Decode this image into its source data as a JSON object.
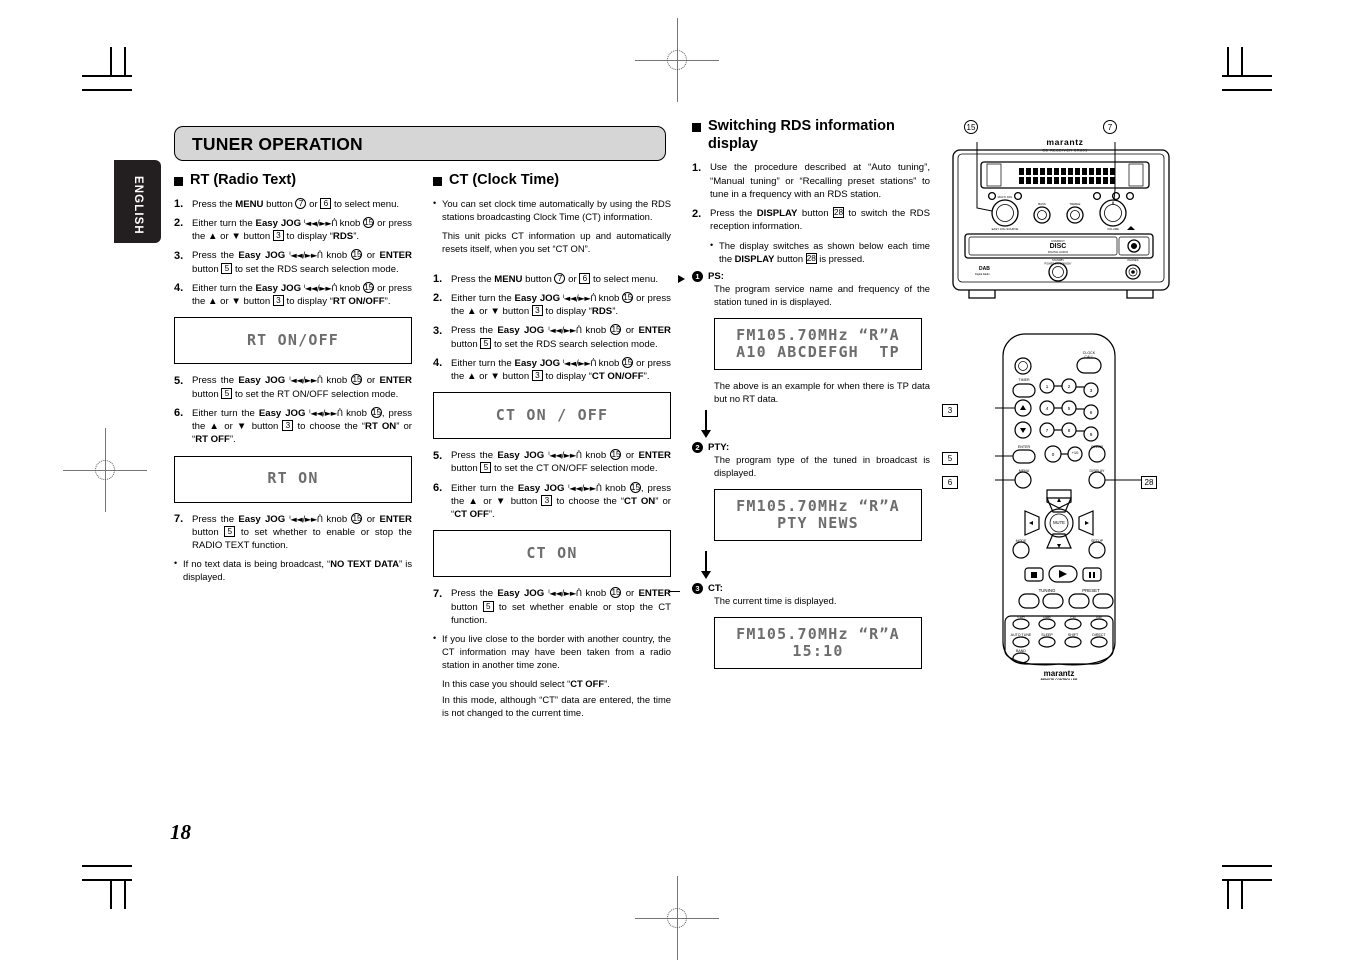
{
  "page": {
    "number": "18",
    "language_tab": "ENGLISH",
    "section_title": "TUNER OPERATION"
  },
  "column_left": {
    "heading": "RT (Radio Text)",
    "steps": [
      {
        "num": "1.",
        "parts": [
          {
            "t": "Press the "
          },
          {
            "t": "MENU",
            "b": true
          },
          {
            "t": " button "
          },
          {
            "t": "7",
            "ref": "circle"
          },
          {
            "t": " or "
          },
          {
            "t": "6",
            "ref": "square"
          },
          {
            "t": " to select menu."
          }
        ]
      },
      {
        "num": "2.",
        "parts": [
          {
            "t": "Either turn the "
          },
          {
            "t": "Easy JOG",
            "b": true
          },
          {
            "t": " ᑊ◄◄/►►ᑏ ",
            "jog": true
          },
          {
            "t": "knob "
          },
          {
            "t": "15",
            "ref": "circle"
          },
          {
            "t": " or press the ▲ or ▼ button "
          },
          {
            "t": "3",
            "ref": "square"
          },
          {
            "t": " to display “"
          },
          {
            "t": "RDS",
            "b": true
          },
          {
            "t": "”."
          }
        ]
      },
      {
        "num": "3.",
        "parts": [
          {
            "t": "Press the "
          },
          {
            "t": "Easy JOG",
            "b": true
          },
          {
            "t": " ᑊ◄◄/►►ᑏ ",
            "jog": true
          },
          {
            "t": "knob "
          },
          {
            "t": "15",
            "ref": "circle"
          },
          {
            "t": " or "
          },
          {
            "t": "ENTER",
            "b": true
          },
          {
            "t": " button "
          },
          {
            "t": "5",
            "ref": "square"
          },
          {
            "t": " to set the RDS search selection mode."
          }
        ]
      },
      {
        "num": "4.",
        "parts": [
          {
            "t": "Either turn the "
          },
          {
            "t": "Easy JOG",
            "b": true
          },
          {
            "t": " ᑊ◄◄/►►ᑏ ",
            "jog": true
          },
          {
            "t": "knob "
          },
          {
            "t": "15",
            "ref": "circle"
          },
          {
            "t": " or press the ▲ or ▼ button "
          },
          {
            "t": "3",
            "ref": "square"
          },
          {
            "t": " to display “"
          },
          {
            "t": "RT ON/OFF",
            "b": true
          },
          {
            "t": "”."
          }
        ]
      }
    ],
    "lcd_1": {
      "lines": [
        "RT ON/OFF"
      ]
    },
    "steps_2": [
      {
        "num": "5.",
        "parts": [
          {
            "t": "Press the "
          },
          {
            "t": "Easy JOG",
            "b": true
          },
          {
            "t": " ᑊ◄◄/►►ᑏ ",
            "jog": true
          },
          {
            "t": "knob "
          },
          {
            "t": "15",
            "ref": "circle"
          },
          {
            "t": " or "
          },
          {
            "t": "ENTER",
            "b": true
          },
          {
            "t": " button "
          },
          {
            "t": "5",
            "ref": "square"
          },
          {
            "t": " to set the RT ON/OFF selection mode."
          }
        ]
      },
      {
        "num": "6.",
        "parts": [
          {
            "t": "Either turn the "
          },
          {
            "t": "Easy JOG",
            "b": true
          },
          {
            "t": " ᑊ◄◄/►►ᑏ ",
            "jog": true
          },
          {
            "t": "knob "
          },
          {
            "t": "15",
            "ref": "circle"
          },
          {
            "t": ", press the ▲ or ▼ button "
          },
          {
            "t": "3",
            "ref": "square"
          },
          {
            "t": " to choose the “"
          },
          {
            "t": "RT ON",
            "b": true
          },
          {
            "t": "” or “"
          },
          {
            "t": "RT OFF",
            "b": true
          },
          {
            "t": "”."
          }
        ]
      }
    ],
    "lcd_2": {
      "lines": [
        "RT ON"
      ]
    },
    "steps_3": [
      {
        "num": "7.",
        "parts": [
          {
            "t": "Press the "
          },
          {
            "t": "Easy JOG",
            "b": true
          },
          {
            "t": " ᑊ◄◄/►►ᑏ ",
            "jog": true
          },
          {
            "t": "knob "
          },
          {
            "t": "15",
            "ref": "circle"
          },
          {
            "t": " or "
          },
          {
            "t": "ENTER",
            "b": true
          },
          {
            "t": " button "
          },
          {
            "t": "5",
            "ref": "square"
          },
          {
            "t": " to set whether to enable or stop the RADIO TEXT function."
          }
        ]
      }
    ],
    "notes": [
      {
        "parts": [
          {
            "t": "If no text data is being broadcast, “"
          },
          {
            "t": "NO TEXT DATA",
            "b": true
          },
          {
            "t": "” is displayed."
          }
        ]
      }
    ]
  },
  "column_mid": {
    "heading": "CT (Clock Time)",
    "intro_notes": [
      {
        "parts": [
          {
            "t": "You can set clock time automatically by using the RDS stations broadcasting Clock Time (CT) information."
          }
        ]
      }
    ],
    "intro_para": "This unit picks CT information up and automatically resets itself, when you set “CT ON”.",
    "steps": [
      {
        "num": "1.",
        "parts": [
          {
            "t": "Press the "
          },
          {
            "t": "MENU",
            "b": true
          },
          {
            "t": " button "
          },
          {
            "t": "7",
            "ref": "circle"
          },
          {
            "t": " or "
          },
          {
            "t": "6",
            "ref": "square"
          },
          {
            "t": " to select menu."
          }
        ]
      },
      {
        "num": "2.",
        "parts": [
          {
            "t": "Either turn the "
          },
          {
            "t": "Easy JOG",
            "b": true
          },
          {
            "t": " ᑊ◄◄/►►ᑏ ",
            "jog": true
          },
          {
            "t": "knob "
          },
          {
            "t": "15",
            "ref": "circle"
          },
          {
            "t": " or press the ▲ or ▼ button "
          },
          {
            "t": "3",
            "ref": "square"
          },
          {
            "t": " to display “"
          },
          {
            "t": "RDS",
            "b": true
          },
          {
            "t": "”."
          }
        ]
      },
      {
        "num": "3.",
        "parts": [
          {
            "t": "Press the "
          },
          {
            "t": "Easy JOG",
            "b": true
          },
          {
            "t": " ᑊ◄◄/►►ᑏ ",
            "jog": true
          },
          {
            "t": "knob "
          },
          {
            "t": "15",
            "ref": "circle"
          },
          {
            "t": " or "
          },
          {
            "t": "ENTER",
            "b": true
          },
          {
            "t": " button "
          },
          {
            "t": "5",
            "ref": "square"
          },
          {
            "t": " to set the RDS search selection mode."
          }
        ]
      },
      {
        "num": "4.",
        "parts": [
          {
            "t": "Either turn the "
          },
          {
            "t": "Easy JOG",
            "b": true
          },
          {
            "t": " ᑊ◄◄/►►ᑏ ",
            "jog": true
          },
          {
            "t": "knob "
          },
          {
            "t": "15",
            "ref": "circle"
          },
          {
            "t": " or press the ▲ or ▼ button "
          },
          {
            "t": "3",
            "ref": "square"
          },
          {
            "t": " to display “"
          },
          {
            "t": "CT ON/OFF",
            "b": true
          },
          {
            "t": "”."
          }
        ]
      }
    ],
    "lcd_1": {
      "lines": [
        "CT ON / OFF"
      ]
    },
    "steps_2": [
      {
        "num": "5.",
        "parts": [
          {
            "t": "Press the "
          },
          {
            "t": "Easy JOG",
            "b": true
          },
          {
            "t": " ᑊ◄◄/►►ᑏ ",
            "jog": true
          },
          {
            "t": "knob "
          },
          {
            "t": "15",
            "ref": "circle"
          },
          {
            "t": " or "
          },
          {
            "t": "ENTER",
            "b": true
          },
          {
            "t": " button "
          },
          {
            "t": "5",
            "ref": "square"
          },
          {
            "t": " to set the CT ON/OFF selection mode."
          }
        ]
      },
      {
        "num": "6.",
        "parts": [
          {
            "t": "Either turn the "
          },
          {
            "t": "Easy JOG",
            "b": true
          },
          {
            "t": " ᑊ◄◄/►►ᑏ ",
            "jog": true
          },
          {
            "t": "knob "
          },
          {
            "t": "15",
            "ref": "circle"
          },
          {
            "t": ", press the ▲ or ▼ button "
          },
          {
            "t": "3",
            "ref": "square"
          },
          {
            "t": " to choose the “"
          },
          {
            "t": "CT ON",
            "b": true
          },
          {
            "t": "” or “"
          },
          {
            "t": "CT OFF",
            "b": true
          },
          {
            "t": "”."
          }
        ]
      }
    ],
    "lcd_2": {
      "lines": [
        "CT ON"
      ]
    },
    "steps_3": [
      {
        "num": "7.",
        "parts": [
          {
            "t": "Press the "
          },
          {
            "t": "Easy JOG",
            "b": true
          },
          {
            "t": " ᑊ◄◄/►►ᑏ ",
            "jog": true
          },
          {
            "t": "knob "
          },
          {
            "t": "15",
            "ref": "circle"
          },
          {
            "t": " or "
          },
          {
            "t": "ENTER",
            "b": true
          },
          {
            "t": " button "
          },
          {
            "t": "5",
            "ref": "square"
          },
          {
            "t": " to set whether enable or stop the CT function."
          }
        ]
      }
    ],
    "notes": [
      {
        "parts": [
          {
            "t": "If you live close to the border with another country, the CT information may have been taken from a radio station in another time zone."
          }
        ]
      }
    ],
    "note_para_1": [
      {
        "t": "In this case you should select “"
      },
      {
        "t": "CT OFF",
        "b": true
      },
      {
        "t": "”."
      }
    ],
    "note_para_2": [
      {
        "t": "In this mode, although “CT” data are entered, the time is not changed to the current time."
      }
    ]
  },
  "column_right": {
    "heading_line_1": "Switching RDS information",
    "heading_line_2": "display",
    "steps": [
      {
        "num": "1.",
        "parts": [
          {
            "t": "Use the procedure described at “Auto tuning”, “Manual tuning” or “Recalling preset stations” to tune in a frequency with an RDS station."
          }
        ]
      },
      {
        "num": "2.",
        "parts": [
          {
            "t": "Press the "
          },
          {
            "t": "DISPLAY",
            "b": true
          },
          {
            "t": " button "
          },
          {
            "t": "28",
            "ref": "square"
          },
          {
            "t": " to switch the RDS reception information."
          }
        ]
      }
    ],
    "step2_note": [
      {
        "t": "The display switches as shown below each time the "
      },
      {
        "t": "DISPLAY",
        "b": true
      },
      {
        "t": " button "
      },
      {
        "t": "28",
        "ref": "square"
      },
      {
        "t": " is pressed."
      }
    ],
    "display_steps": [
      {
        "num": "1",
        "label": "PS:",
        "body": "The program service name and frequency of the station tuned in is displayed.",
        "lcd": {
          "lines": [
            "FM105.70MHz “R”A",
            "A10 ABCDEFGH  TP"
          ]
        },
        "after": "The above is an example for when there is TP data but no RT data."
      },
      {
        "num": "2",
        "label": "PTY:",
        "body": "The program type of the tuned in broadcast is displayed.",
        "lcd": {
          "lines": [
            "FM105.70MHz “R”A",
            "PTY NEWS"
          ]
        },
        "after": ""
      },
      {
        "num": "3",
        "label": "CT:",
        "body": "The current time is displayed.",
        "lcd": {
          "lines": [
            "FM105.70MHz “R”A",
            "15:10"
          ]
        },
        "after": ""
      }
    ]
  },
  "illustrations": {
    "unit": {
      "brand": "marantz",
      "brand_sub": "CD RECEIVER CR601",
      "callout_left": "15",
      "callout_right": "7",
      "knob_labels": [
        "MULTI JOG",
        "EASY JOG SOURCE",
        "BASS",
        "TREBLE",
        "VOLUME"
      ],
      "tray_label": "DISC",
      "badge": "DAB",
      "standby_label": "STANDBY / POWER ON STANDBY",
      "phones_label": "PHONES"
    },
    "remote": {
      "brand": "marantz",
      "brand_sub_1": "REMOTE CONTROLLER",
      "brand_sub_2": "RC8101CR",
      "callouts": [
        "3",
        "5",
        "6",
        "28"
      ],
      "buttons": {
        "power": "power-icon",
        "clock_call": "CLOCK CALL",
        "timer": "TIMER",
        "numbers": [
          "1",
          "2",
          "3",
          "4",
          "5",
          "6",
          "7",
          "8",
          "9"
        ],
        "up": "▲",
        "down": "▼",
        "enter": "ENTER",
        "zero": "0",
        "plus10": "+10",
        "clear": "CLEAR",
        "menu": "MENU",
        "display": "DISPLAY",
        "mode": "MODE",
        "setup": "SETUP",
        "mute": "MUTE",
        "stop": "■",
        "play": "►",
        "pause": "❙❙",
        "tuning": "TUNING",
        "preset": "PRESET",
        "source_row": [
          "CDR",
          "DAB",
          "FM",
          "AM"
        ],
        "function_row": [
          "AUTO TUNE",
          "SLEEP",
          "SHIFT",
          "DIRECT"
        ],
        "last_row": [
          "BAND"
        ]
      }
    }
  },
  "colors": {
    "header_bar": "#d6d6d6",
    "lang_tab": "#231f20",
    "lcd_text": "#6d6d6d"
  }
}
